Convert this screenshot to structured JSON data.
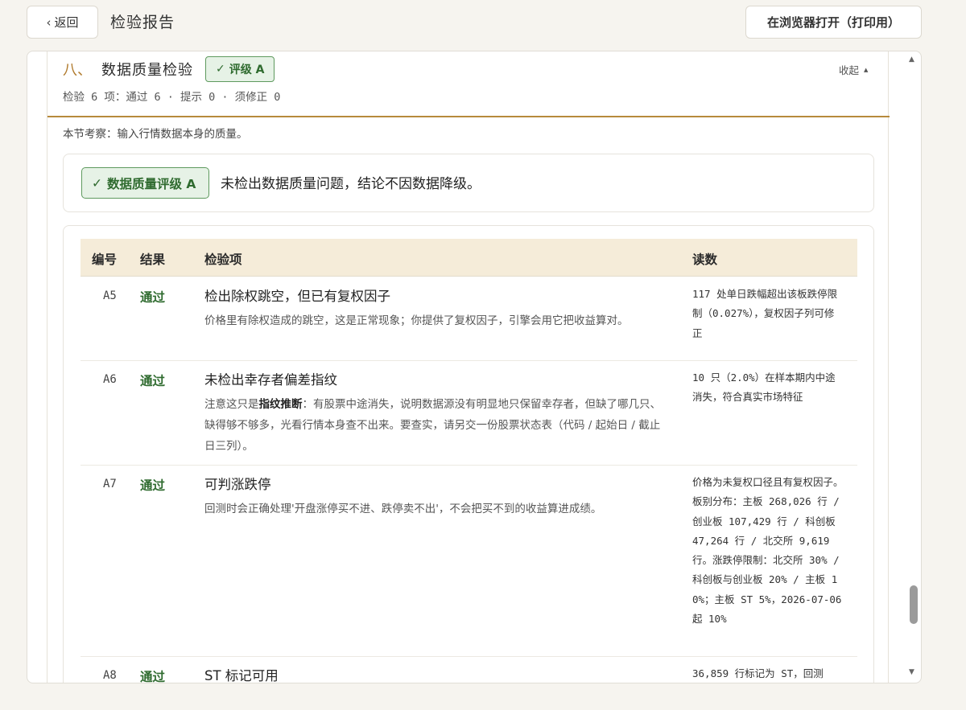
{
  "header": {
    "back_label": "返回",
    "title": "检验报告",
    "print_label": "在浏览器打开（打印用）"
  },
  "section": {
    "number": "八、",
    "title": "数据质量检验",
    "grade_badge": "评级 A",
    "summary": "检验 6 项：通过 6 · 提示 0 · 须修正 0",
    "collapse_label": "收起",
    "description": "本节考察：输入行情数据本身的质量。"
  },
  "verdict": {
    "badge": "数据质量评级 A",
    "text": "未检出数据质量问题，结论不因数据降级。"
  },
  "table": {
    "headers": {
      "id": "编号",
      "result": "结果",
      "item": "检验项",
      "reading": "读数"
    },
    "rows": [
      {
        "id": "A5",
        "result": "通过",
        "title": "检出除权跳空，但已有复权因子",
        "desc_pre": "价格里有除权造成的跳空，这是正常现象；你提供了复权因子，引擎会用它把收益算对。",
        "desc_bold": "",
        "desc_post": "",
        "reading": "117 处单日跌幅超出该板跌停限制（0.027%），复权因子列可修正"
      },
      {
        "id": "A6",
        "result": "通过",
        "title": "未检出幸存者偏差指纹",
        "desc_pre": "注意这只是",
        "desc_bold": "指纹推断",
        "desc_post": "：有股票中途消失，说明数据源没有明显地只保留幸存者，但缺了哪几只、缺得够不够多，光看行情本身查不出来。要查实，请另交一份股票状态表（代码 / 起始日 / 截止日三列）。",
        "reading": "10 只（2.0%）在样本期内中途消失，符合真实市场特征"
      },
      {
        "id": "A7",
        "result": "通过",
        "title": "可判涨跌停",
        "desc_pre": "回测时会正确处理'开盘涨停买不进、跌停卖不出'，不会把买不到的收益算进成绩。",
        "desc_bold": "",
        "desc_post": "",
        "reading": "价格为未复权口径且有复权因子。板别分布：主板 268,026 行 / 创业板 107,429 行 / 科创板 47,264 行 / 北交所 9,619 行。涨跌停限制：北交所 30% / 科创板与创业板 20% / 主板 10%；主板 ST 5%，2026-07-06 起 10%"
      },
      {
        "id": "A8",
        "result": "通过",
        "title": "ST 标记可用",
        "desc_pre": "",
        "desc_bold": "",
        "desc_post": "",
        "reading": "36,859 行标记为 ST，回测"
      }
    ]
  },
  "icons": {
    "back": "chevron-left-icon",
    "check": "check-icon",
    "collapse": "triangle-up-icon"
  },
  "colors": {
    "accent": "#b78a3c",
    "pass_green": "#2f6b2f",
    "badge_bg": "#e6f2e6",
    "header_bg": "#f5ecd9"
  }
}
